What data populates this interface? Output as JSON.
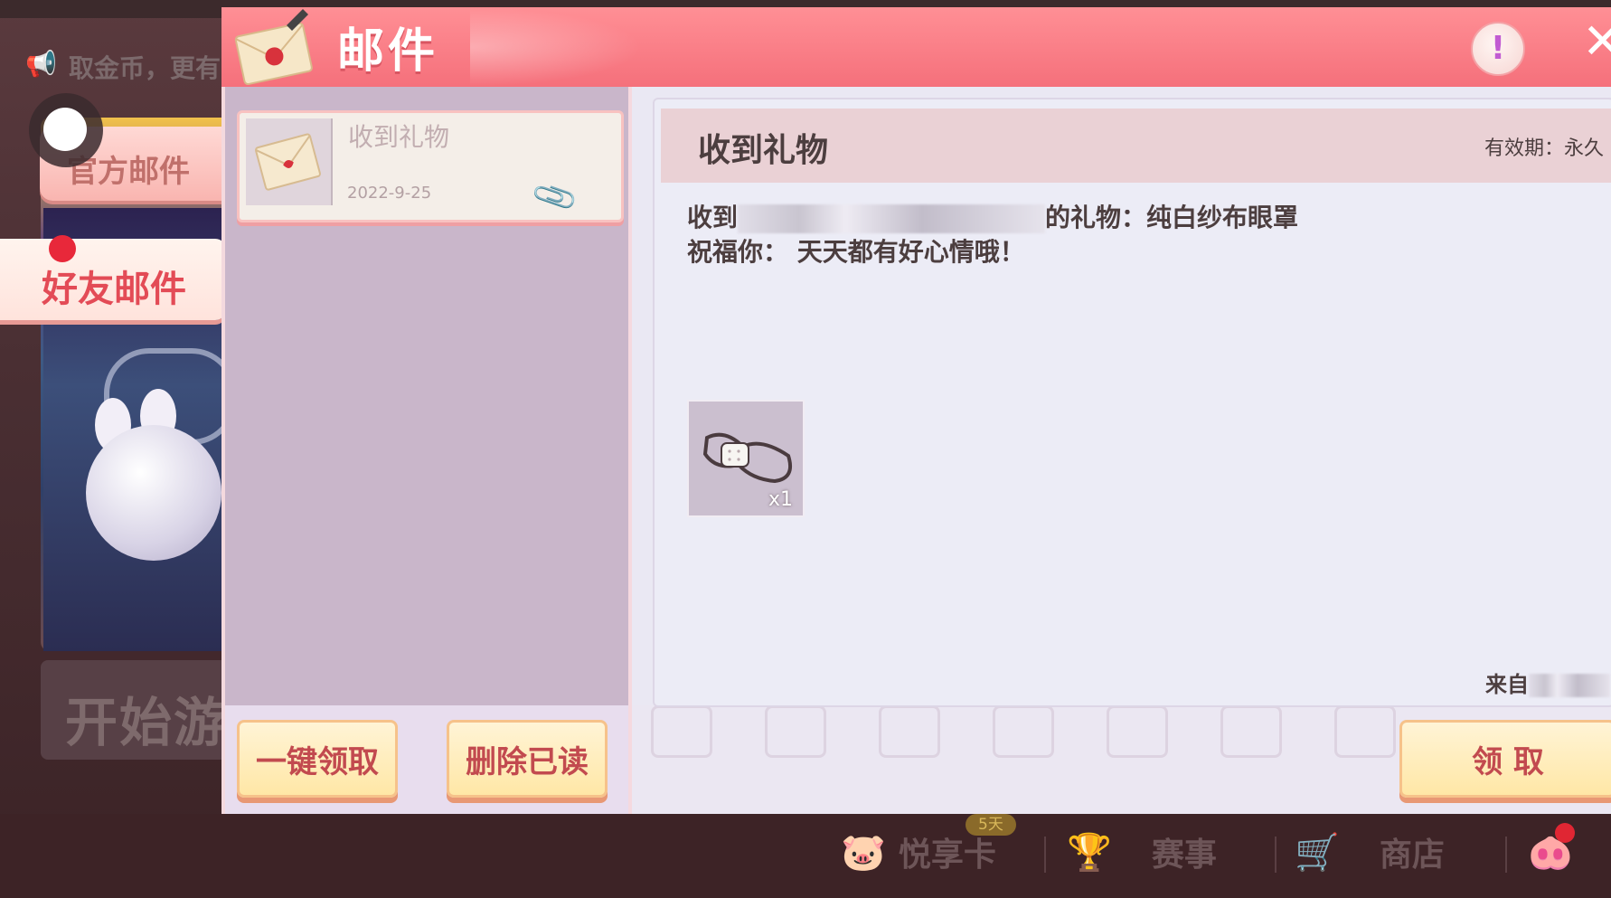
{
  "background": {
    "notice_text": "取金币，更有",
    "start_label": "开始游"
  },
  "header": {
    "title": "邮件",
    "info_symbol": "!",
    "close_symbol": "✕"
  },
  "tabs": [
    {
      "label": "官方邮件",
      "selected": false
    },
    {
      "label": "好友邮件",
      "selected": true
    }
  ],
  "mail_list": {
    "items": [
      {
        "title": "收到礼物",
        "date": "2022-9-25",
        "has_attachment": true
      }
    ],
    "claim_all_label": "一键领取",
    "delete_read_label": "删除已读"
  },
  "detail": {
    "title": "收到礼物",
    "validity": "有效期：永久",
    "line1_prefix": "收到",
    "line1_suffix": "的礼物：纯白纱布眼罩",
    "line2_prefix": "祝福你：",
    "line2_text": "天天都有好心情哦！",
    "attachment": {
      "name": "纯白纱布眼罩",
      "icon": "eye-mask-icon",
      "quantity": "x1"
    },
    "from_label": "来自",
    "claim_label": "领 取"
  },
  "bottom_bar": {
    "items": [
      {
        "label": "悦享卡",
        "icon": "pig-icon"
      },
      {
        "label": "赛事",
        "icon": "trophy-icon"
      },
      {
        "label": "商店",
        "icon": "cart-icon"
      }
    ],
    "badge": "5天"
  },
  "colors": {
    "header": "#f5707b",
    "button_text": "#c24a4f",
    "button_bg": "#ffe7a6",
    "list_bg": "#c9b6ca",
    "detail_header_bg": "#ead1d5"
  }
}
